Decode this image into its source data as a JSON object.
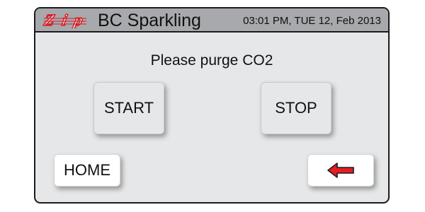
{
  "header": {
    "logo_text": "Zip",
    "app_title": "BC Sparkling",
    "datetime": "03:01 PM, TUE 12, Feb 2013"
  },
  "main": {
    "prompt": "Please purge CO2",
    "start_label": "START",
    "stop_label": "STOP"
  },
  "nav": {
    "home_label": "HOME",
    "back_icon": "left-arrow-icon"
  },
  "colors": {
    "title_bar": "#a7a9ac",
    "screen_bg": "#e6e7e8",
    "logo_red": "#d71f26",
    "arrow_red": "#e41e26",
    "frame": "#1b1b1b"
  }
}
